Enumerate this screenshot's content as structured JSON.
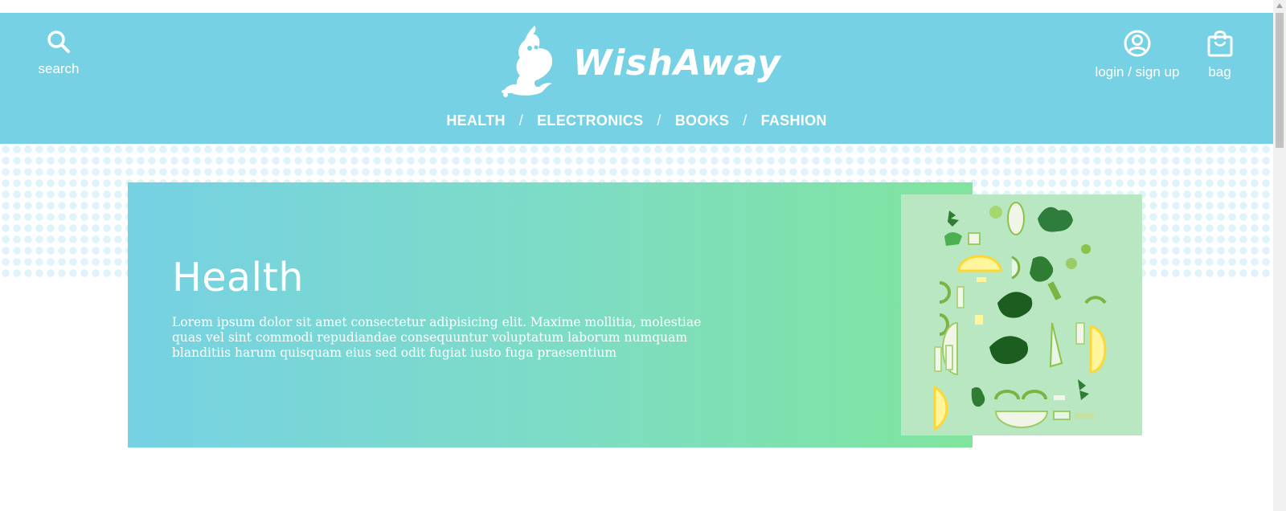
{
  "header": {
    "search_label": "search",
    "login_label": "login / sign up",
    "bag_label": "bag",
    "logo_text": "WishAway",
    "nav": [
      {
        "label": "HEALTH"
      },
      {
        "label": "ELECTRONICS"
      },
      {
        "label": "BOOKS"
      },
      {
        "label": "FASHION"
      }
    ],
    "nav_separator": "/",
    "icons": {
      "search": "search-icon",
      "user": "user-icon",
      "bag": "bag-icon",
      "logo": "genie-lamp-icon"
    }
  },
  "hero": {
    "title": "Health",
    "description": "Lorem ipsum dolor sit amet consectetur adipisicing elit. Maxime mollitia, molestiae quas vel sint commodi repudiandae consequuntur voluptatum laborum numquam blanditiis harum quisquam eius sed odit fugiat iusto fuga praesentium",
    "image_alt": "flat lay of green vegetables and lemon slices"
  },
  "colors": {
    "header_bg": "#75d1e3",
    "hero_gradient_start": "#76d1e3",
    "hero_gradient_end": "#80e49d",
    "text_light": "#ffffff"
  }
}
